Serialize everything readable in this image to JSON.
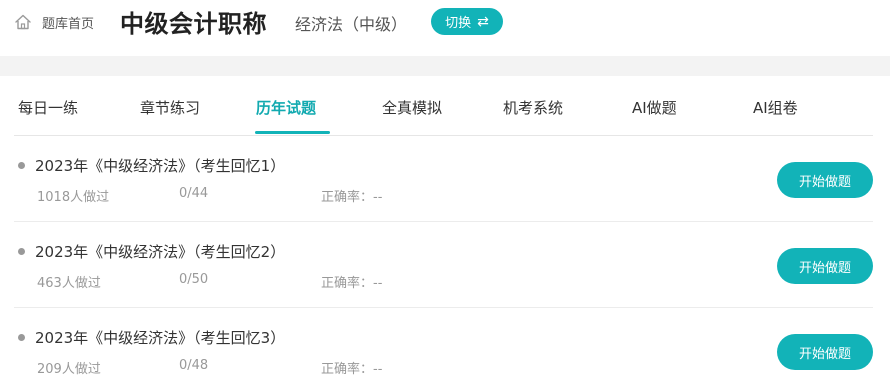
{
  "header": {
    "home_icon": "home-icon",
    "home_label": "题库首页",
    "title": "中级会计职称",
    "subject": "经济法（中级）",
    "switch_label": "切换",
    "switch_icon": "swap-arrows-icon",
    "accent_color": "#12b3b8"
  },
  "tabs": [
    {
      "label": "每日一练"
    },
    {
      "label": "章节练习"
    },
    {
      "label": "历年试题",
      "active": true
    },
    {
      "label": "全真模拟"
    },
    {
      "label": "机考系统"
    },
    {
      "label": "AI做题"
    },
    {
      "label": "AI组卷"
    }
  ],
  "papers": [
    {
      "title": "2023年《中级经济法》（考生回忆1）",
      "takers": "1018人做过",
      "progress": "0/44",
      "accuracy_label": "正确率：",
      "accuracy": "--",
      "button": "开始做题"
    },
    {
      "title": "2023年《中级经济法》（考生回忆2）",
      "takers": "463人做过",
      "progress": "0/50",
      "accuracy_label": "正确率：",
      "accuracy": "--",
      "button": "开始做题"
    },
    {
      "title": "2023年《中级经济法》（考生回忆3）",
      "takers": "209人做过",
      "progress": "0/48",
      "accuracy_label": "正确率：",
      "accuracy": "--",
      "button": "开始做题"
    }
  ]
}
